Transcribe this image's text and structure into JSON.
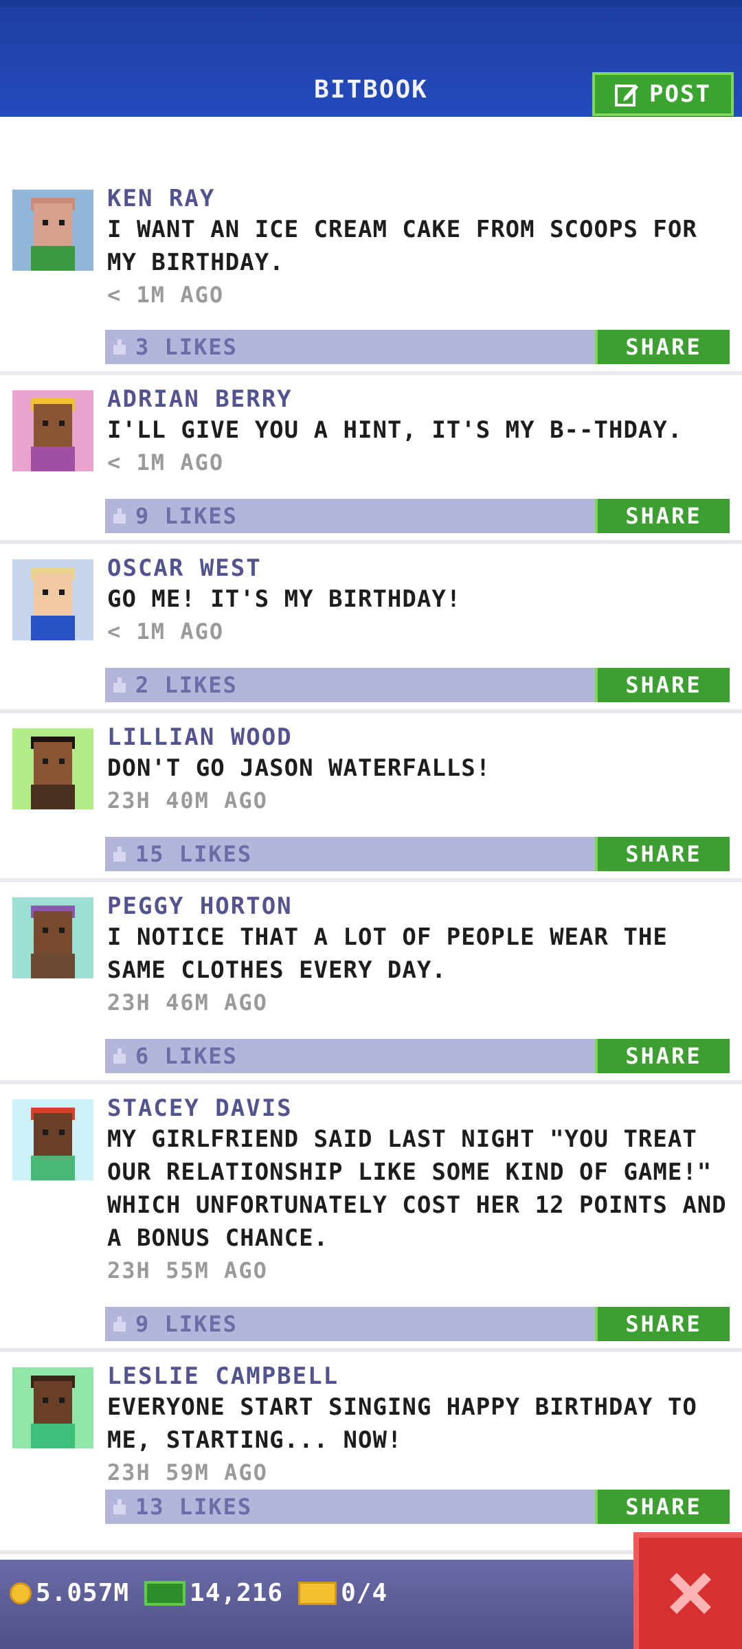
{
  "header": {
    "title": "BITBOOK",
    "post_label": "POST"
  },
  "colors": {
    "header_bg": "#234bbd",
    "name": "#53548f",
    "bar": "#b4b5da",
    "share": "#3d9f32",
    "close": "#d63030"
  },
  "posts": [
    {
      "name": "KEN RAY",
      "text": "I WANT AN ICE CREAM CAKE FROM SCOOPS FOR MY BIRTHDAY.",
      "time": "< 1M AGO",
      "likes": "3 LIKES",
      "share": "SHARE",
      "avatar_bg": "#91b6d8",
      "skin": "#d8a08e",
      "shirt": "#3a9a40",
      "hair": "#c98c78"
    },
    {
      "name": "ADRIAN BERRY",
      "text": "I'LL GIVE YOU A HINT, IT'S MY B--THDAY.",
      "time": "< 1M AGO",
      "likes": "9 LIKES",
      "share": "SHARE",
      "avatar_bg": "#e8a4cf",
      "skin": "#8a5535",
      "shirt": "#a14fa3",
      "hair": "#f0c233"
    },
    {
      "name": "OSCAR WEST",
      "text": "GO ME! IT'S MY BIRTHDAY!",
      "time": "< 1M AGO",
      "likes": "2 LIKES",
      "share": "SHARE",
      "avatar_bg": "#c6d6ee",
      "skin": "#f0c9a0",
      "shirt": "#2852c4",
      "hair": "#e8d48c"
    },
    {
      "name": "LILLIAN WOOD",
      "text": "DON'T GO JASON WATERFALLS!",
      "time": "23H 40M AGO",
      "likes": "15 LIKES",
      "share": "SHARE",
      "avatar_bg": "#b2ec86",
      "skin": "#8a5535",
      "shirt": "#4b2f1e",
      "hair": "#1c1410"
    },
    {
      "name": "PEGGY HORTON",
      "text": "I NOTICE THAT A LOT OF PEOPLE WEAR THE SAME CLOTHES EVERY DAY.",
      "time": "23H 46M AGO",
      "likes": "6 LIKES",
      "share": "SHARE",
      "avatar_bg": "#9be0d3",
      "skin": "#7a4a2f",
      "shirt": "#6a4a34",
      "hair": "#8a56b0"
    },
    {
      "name": "STACEY DAVIS",
      "text": "MY GIRLFRIEND SAID LAST NIGHT \"YOU TREAT OUR RELATIONSHIP LIKE SOME KIND OF GAME!\" WHICH UNFORTUNATELY COST HER 12 POINTS AND A BONUS CHANCE.",
      "time": "23H 55M AGO",
      "likes": "9 LIKES",
      "share": "SHARE",
      "avatar_bg": "#ccf1f9",
      "skin": "#6a3f27",
      "shirt": "#49b877",
      "hair": "#d8402c"
    },
    {
      "name": "LESLIE CAMPBELL",
      "text": "EVERYONE START SINGING HAPPY BIRTHDAY TO ME, STARTING... NOW!",
      "time": "23H 59M AGO",
      "likes": "13 LIKES",
      "share": "SHARE",
      "avatar_bg": "#8fe6a8",
      "skin": "#6a3f27",
      "shirt": "#3ec07a",
      "hair": "#3a2418"
    }
  ],
  "footer": {
    "coins": "5.057M",
    "bux": "14,216",
    "tickets": "0/4"
  }
}
